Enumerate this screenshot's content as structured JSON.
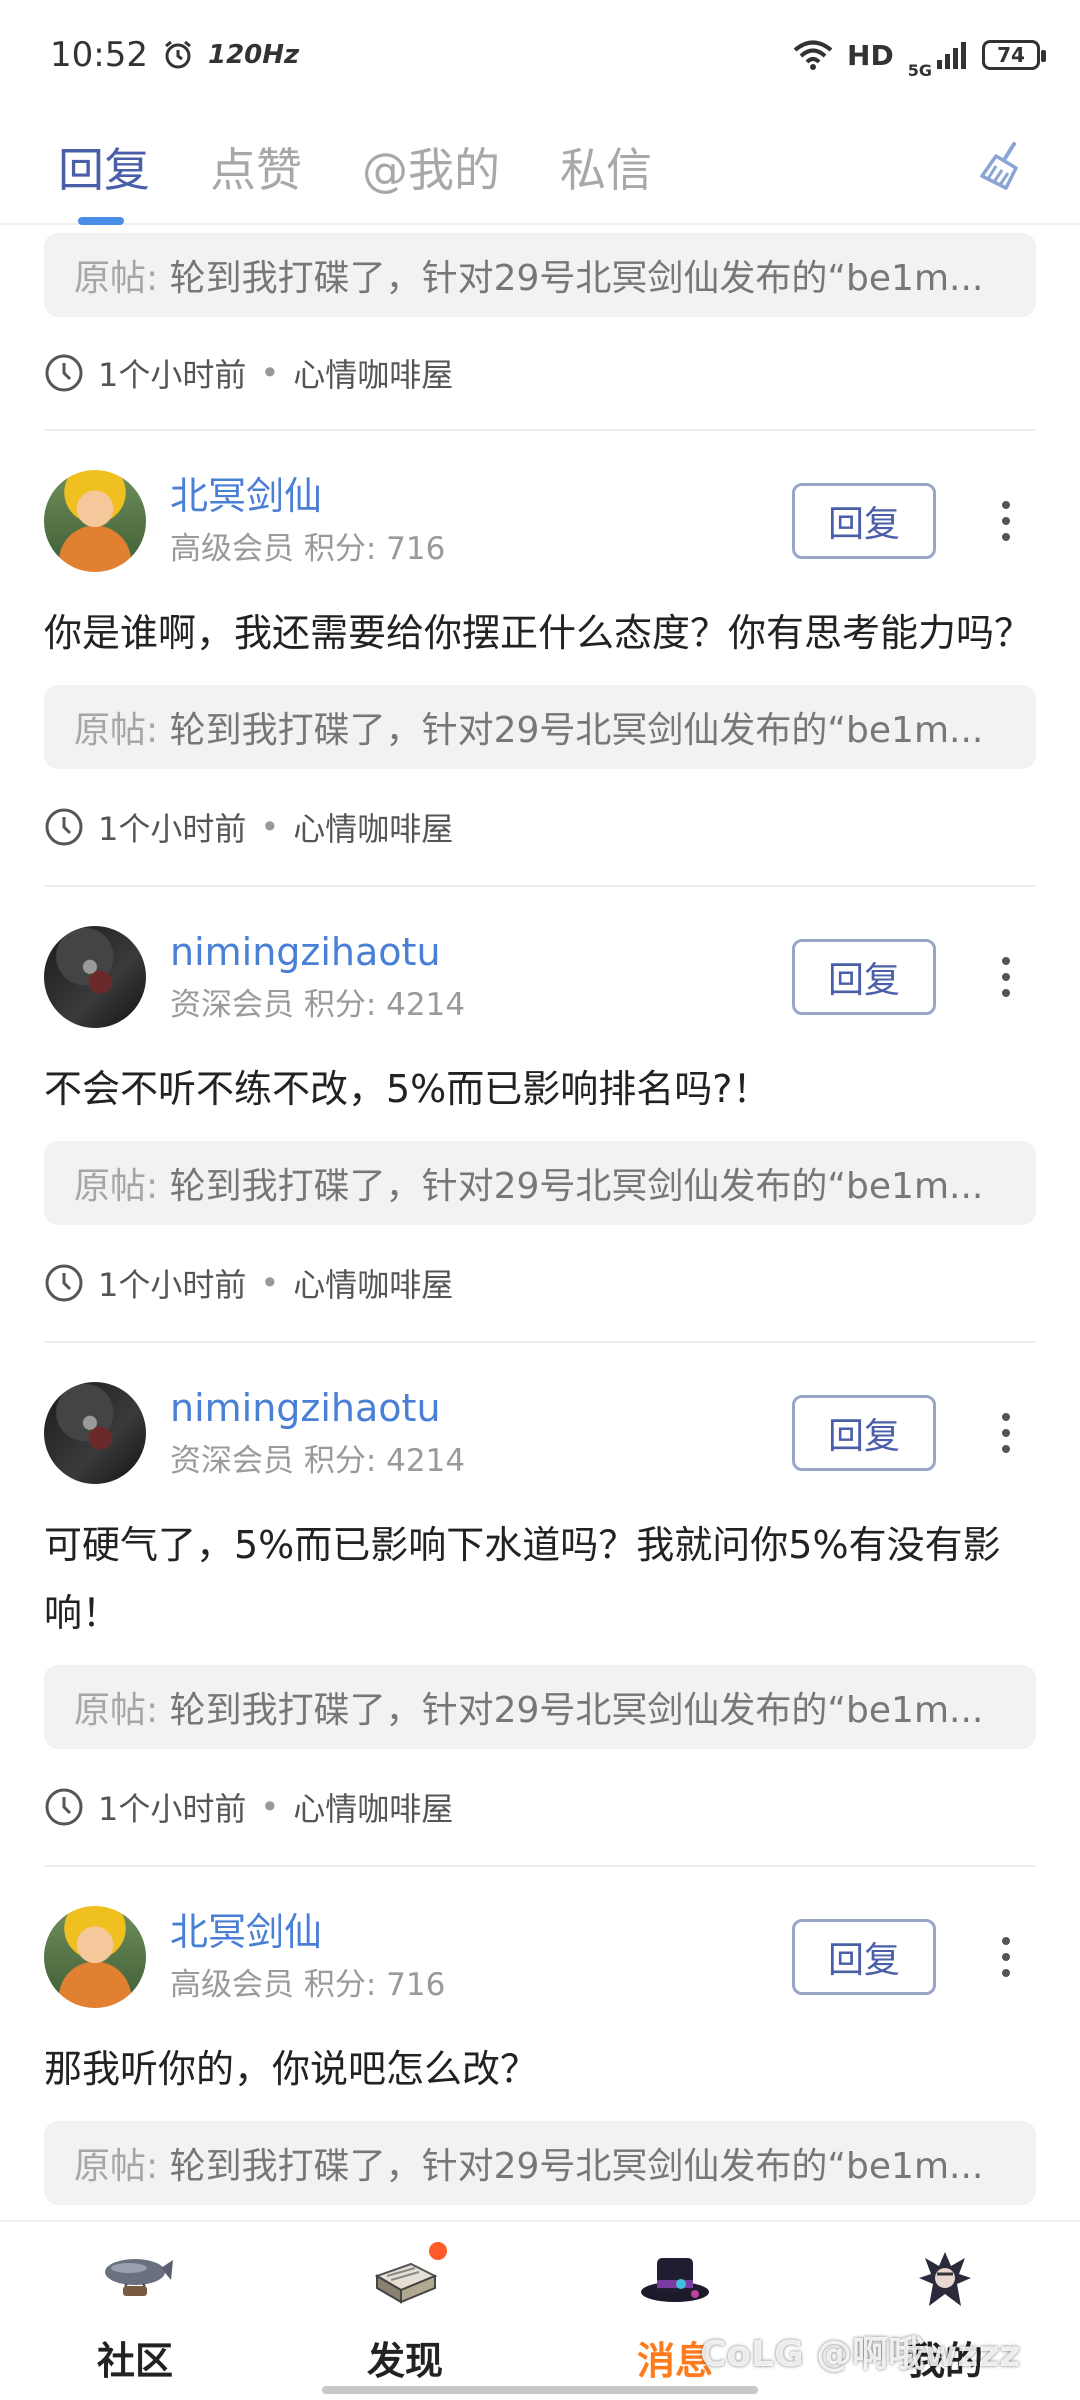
{
  "status_bar": {
    "time": "10:52",
    "refresh_rate": "120Hz",
    "network": "HD",
    "signal": "5G",
    "battery": "74"
  },
  "tabs": [
    {
      "label": "回复",
      "active": true
    },
    {
      "label": "点赞",
      "active": false
    },
    {
      "label": "@我的",
      "active": false
    },
    {
      "label": "私信",
      "active": false
    }
  ],
  "reply_button_label": "回复",
  "orig_label": "原帖:",
  "first_card": {
    "orig_post": "轮到我打碟了，针对29号北冥剑仙发布的“be1m...",
    "time": "1个小时前",
    "forum": "心情咖啡屋"
  },
  "replies": [
    {
      "name": "北冥剑仙",
      "meta": "高级会员 积分: 716",
      "content": "你是谁啊，我还需要给你摆正什么态度？你有思考能力吗？",
      "orig_post": "轮到我打碟了，针对29号北冥剑仙发布的“be1m...",
      "time": "1个小时前",
      "forum": "心情咖啡屋"
    },
    {
      "name": "nimingzihaotu",
      "meta": "资深会员 积分: 4214",
      "content": "不会不听不练不改，5%而已影响排名吗?！",
      "orig_post": "轮到我打碟了，针对29号北冥剑仙发布的“be1m...",
      "time": "1个小时前",
      "forum": "心情咖啡屋"
    },
    {
      "name": "nimingzihaotu",
      "meta": "资深会员 积分: 4214",
      "content": "可硬气了，5%而已影响下水道吗？我就问你5%有没有影响！",
      "orig_post": "轮到我打碟了，针对29号北冥剑仙发布的“be1m...",
      "time": "1个小时前",
      "forum": "心情咖啡屋"
    },
    {
      "name": "北冥剑仙",
      "meta": "高级会员 积分: 716",
      "content": "那我听你的，你说吧怎么改？",
      "orig_post": "轮到我打碟了，针对29号北冥剑仙发布的“be1m...",
      "time": "1个小时前",
      "forum": "心情咖啡屋"
    }
  ],
  "bottom_nav": [
    {
      "label": "社区",
      "icon": "airship-icon",
      "active": false
    },
    {
      "label": "发现",
      "icon": "book-icon",
      "active": false
    },
    {
      "label": "消息",
      "icon": "hat-icon",
      "active": true
    },
    {
      "label": "我的",
      "icon": "character-icon",
      "active": false
    }
  ],
  "watermark": "CoLG @啊哦wzzz",
  "colors": {
    "accent": "#4a5fa8",
    "link": "#4a7fd6",
    "active_nav": "#ff7a1a",
    "badge": "#ff5a2a"
  }
}
